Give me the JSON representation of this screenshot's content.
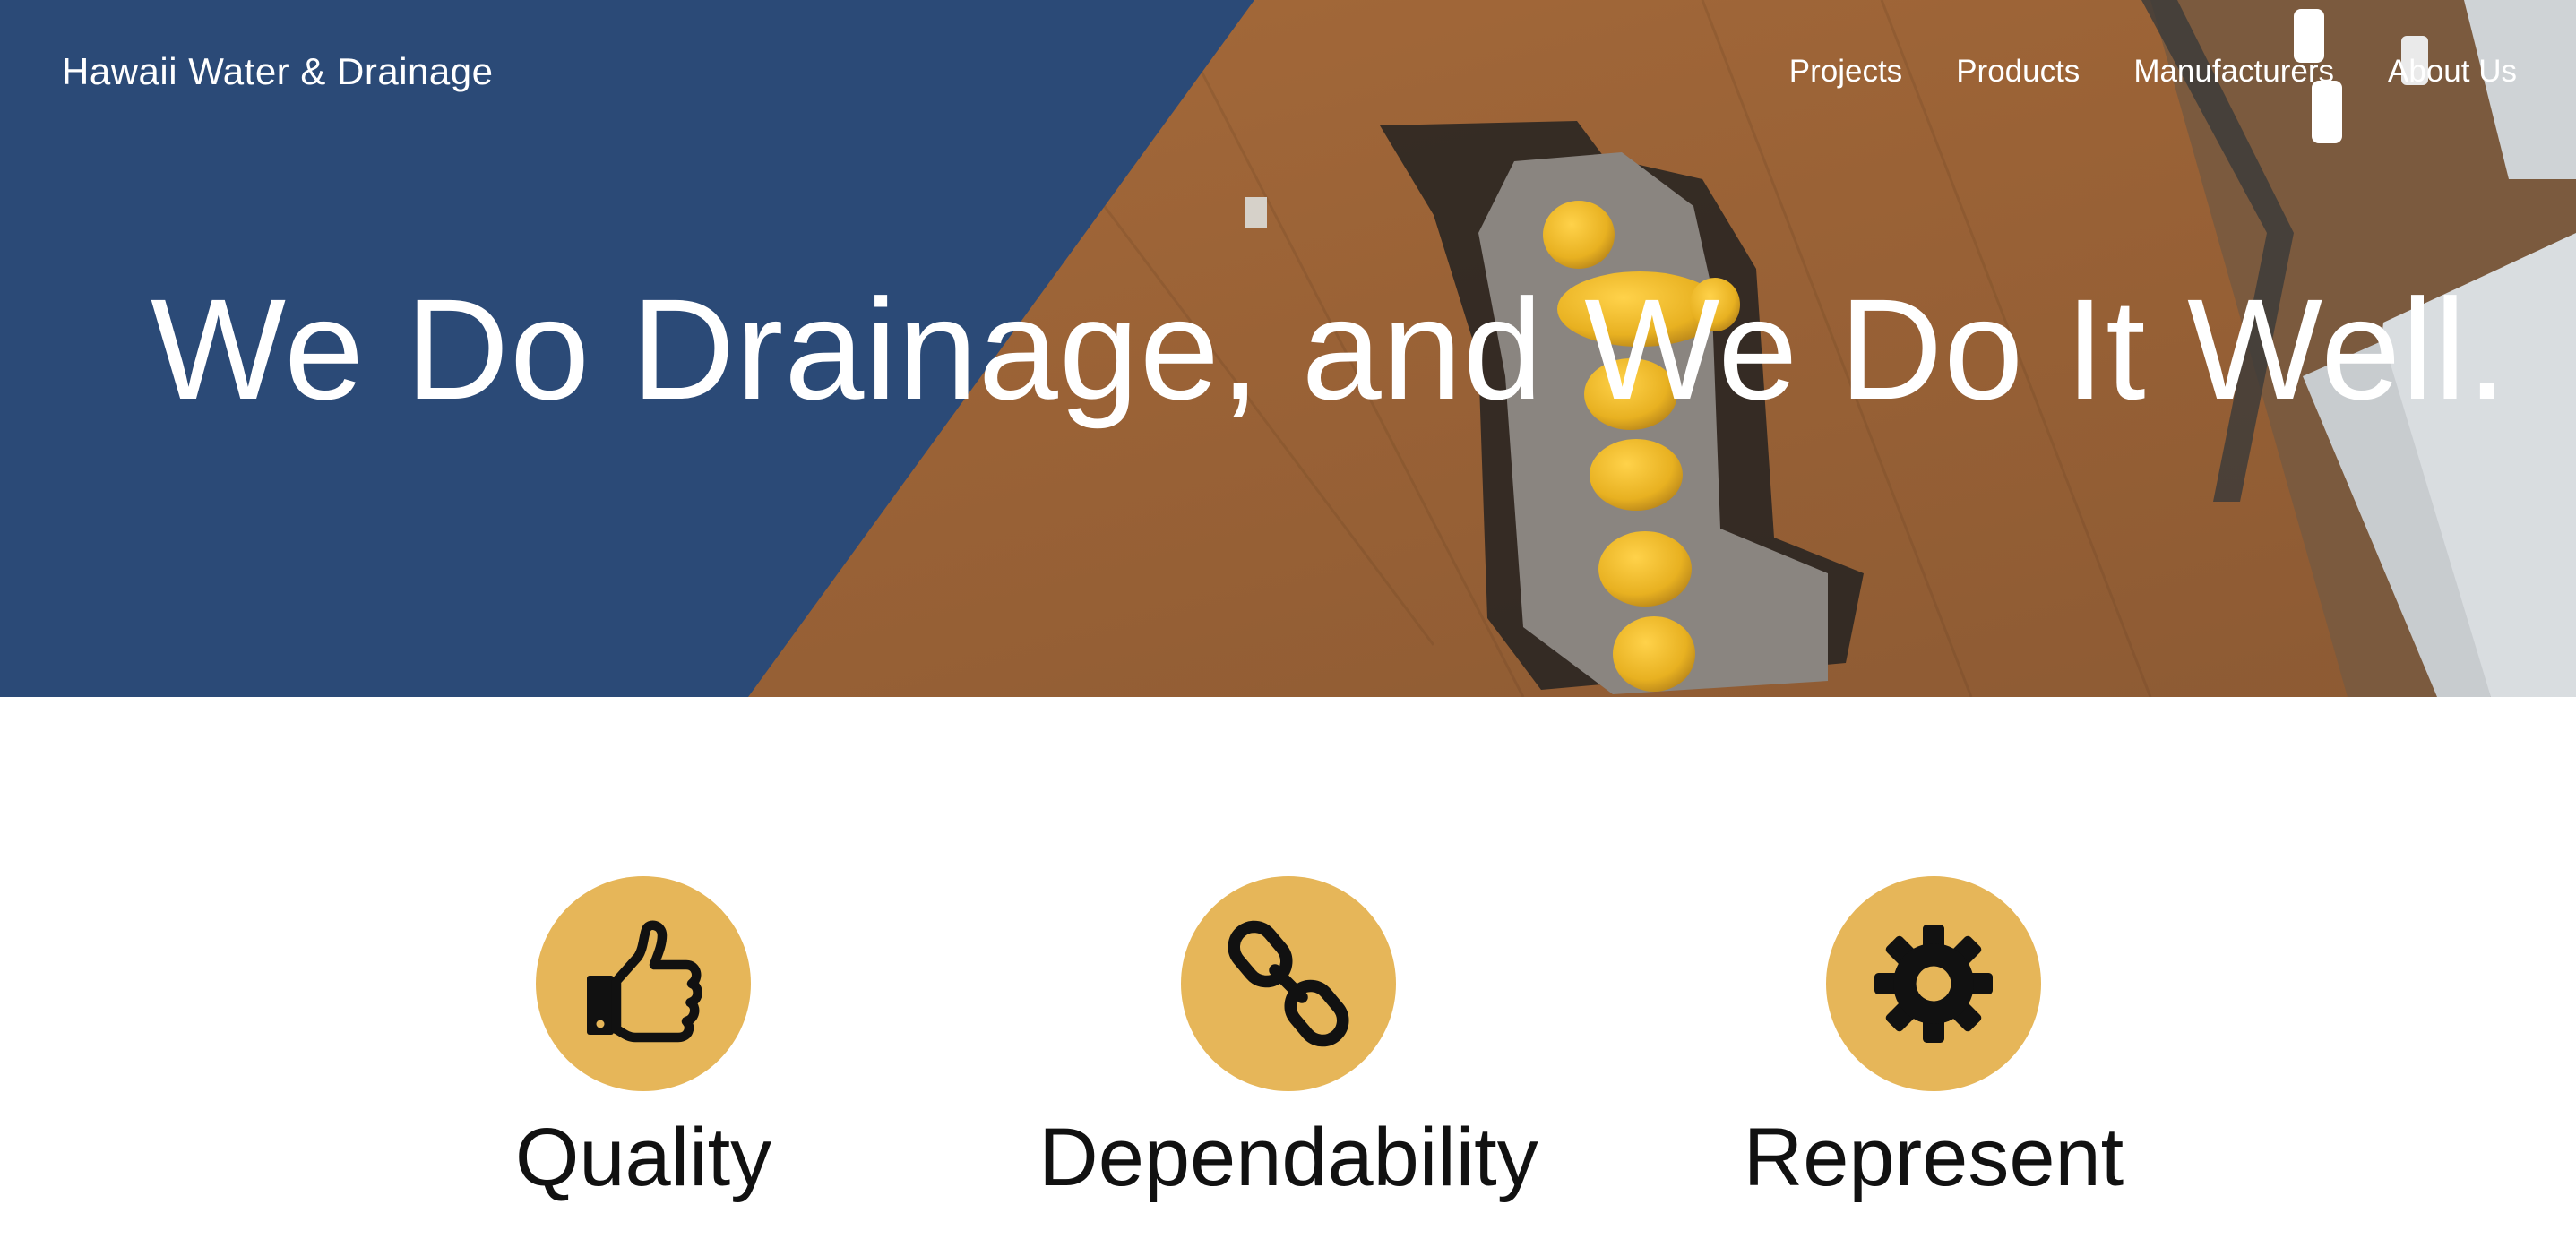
{
  "brand": "Hawaii Water & Drainage",
  "nav": [
    "Projects",
    "Products",
    "Manufacturers",
    "About Us"
  ],
  "hero": {
    "headline": "We Do Drainage, and We Do It Well."
  },
  "features": [
    {
      "title": "Quality",
      "icon": "thumbs-up-icon"
    },
    {
      "title": "Dependability",
      "icon": "chain-link-icon"
    },
    {
      "title": "Represent",
      "icon": "gear-icon"
    }
  ],
  "colors": {
    "navy": "#2b4a77",
    "gold": "#e6b659",
    "dirt": "#9d6539",
    "icon": "#111111"
  }
}
